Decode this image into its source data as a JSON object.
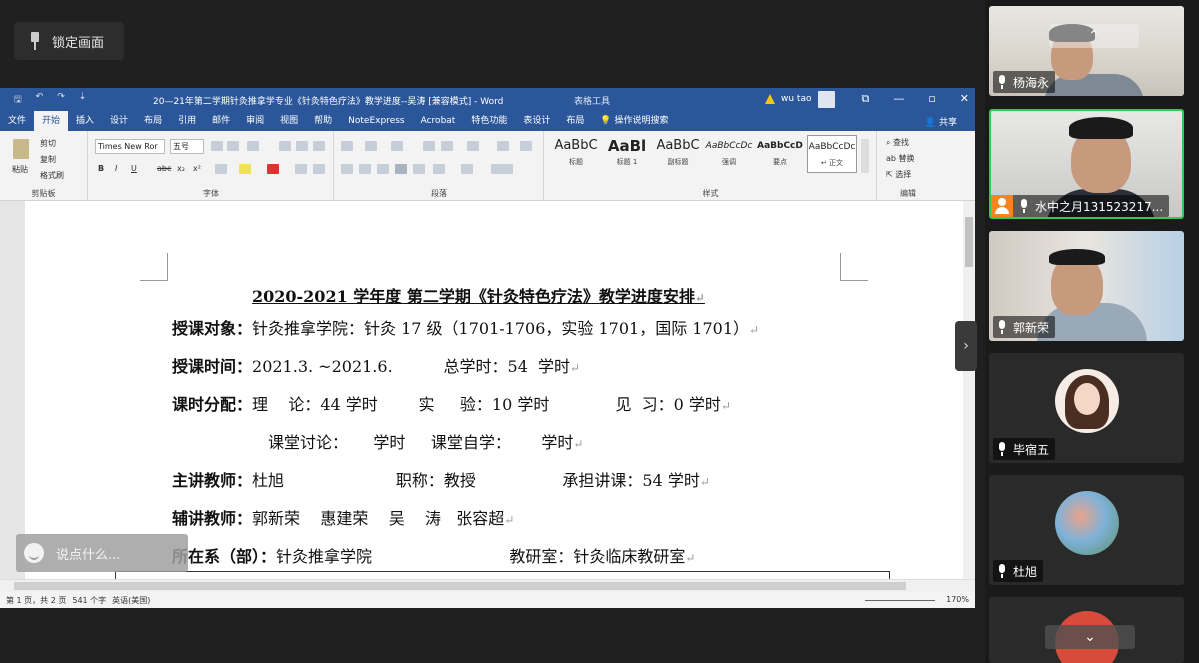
{
  "lock_button": {
    "label": "锁定画面"
  },
  "word": {
    "quick_access": [
      "🖫",
      "↶",
      "↷",
      "⇣"
    ],
    "title": "20—21年第二学期针灸推拿学专业《针灸特色疗法》教学进度--吴涛 [兼容模式] - Word",
    "context_tab": "表格工具",
    "user": "wu tao",
    "window_buttons": [
      "⧉",
      "—",
      "▫",
      "✕"
    ],
    "tabs": [
      "文件",
      "开始",
      "插入",
      "设计",
      "布局",
      "引用",
      "邮件",
      "审阅",
      "视图",
      "帮助",
      "NoteExpress",
      "Acrobat",
      "特色功能",
      "表设计",
      "布局",
      "操作说明搜索"
    ],
    "share": "共享",
    "ribbon": {
      "clipboard": {
        "paste": "粘贴",
        "cut": "剪切",
        "copy": "复制",
        "format_painter": "格式刷",
        "label": "剪贴板"
      },
      "font": {
        "font_name": "Times New Ror",
        "font_size": "五号",
        "label": "字体"
      },
      "paragraph": {
        "label": "段落"
      },
      "styles": {
        "items": [
          {
            "sample": "AaBbC",
            "name": "标题"
          },
          {
            "sample": "AaBl",
            "name": "标题 1"
          },
          {
            "sample": "AaBbC",
            "name": "副标题"
          },
          {
            "sample": "AaBbCcDc",
            "name": "强调"
          },
          {
            "sample": "AaBbCcD",
            "name": "要点"
          },
          {
            "sample": "AaBbCcDc",
            "name": "↵ 正文"
          }
        ],
        "label": "样式"
      },
      "editing": {
        "find": "查找",
        "replace": "替换",
        "select": "选择",
        "label": "编辑"
      }
    },
    "document": {
      "title": "2020-2021 学年度 第二学期《针灸特色疗法》教学进度安排",
      "lines": [
        {
          "label": "授课对象：",
          "text": "针灸推拿学院：针灸 17 级（1701-1706，实验 1701，国际 1701）"
        },
        {
          "label": "授课时间：",
          "text": "2021.3. ~2021.6.          总学时：54  学时"
        },
        {
          "label": "课时分配：",
          "text": "理    论：44 学时        实     验：10 学时             见  习：0 学时"
        },
        {
          "label": "",
          "text": "课堂讨论：     学时     课堂自学：      学时"
        },
        {
          "label": "主讲教师：",
          "text": "杜旭                      职称：教授                 承担讲课：54 学时"
        },
        {
          "label": "辅讲教师：",
          "text": "郭新荣    惠建荣    吴    涛   张容超"
        },
        {
          "label": "所在系（部）：",
          "text": "针灸推拿学院                           教研室：针灸临床教研室"
        }
      ],
      "pilcrow": "↵"
    },
    "status": {
      "page": "第 1 页，共 2 页",
      "words": "541 个字",
      "lang": "英语(美国)",
      "zoom": "170%"
    }
  },
  "chat_input": {
    "placeholder": "说点什么..."
  },
  "participants": [
    {
      "name": "杨海永"
    },
    {
      "name": "水中之月131523217..."
    },
    {
      "name": "郭新荣"
    },
    {
      "name": "毕宿五"
    },
    {
      "name": "杜旭"
    }
  ]
}
